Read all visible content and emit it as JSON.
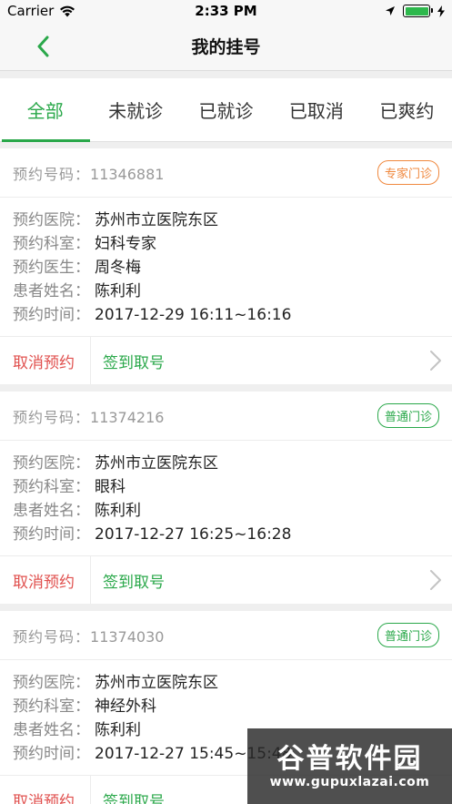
{
  "status_bar": {
    "carrier": "Carrier",
    "time": "2:33 PM"
  },
  "nav": {
    "title": "我的挂号"
  },
  "tabs": [
    {
      "label": "全部",
      "active": true
    },
    {
      "label": "未就诊",
      "active": false
    },
    {
      "label": "已就诊",
      "active": false
    },
    {
      "label": "已取消",
      "active": false
    },
    {
      "label": "已爽约",
      "active": false
    }
  ],
  "labels": {
    "appt_no": "预约号码：",
    "hospital": "预约医院：",
    "department": "预约科室：",
    "doctor": "预约医生：",
    "patient": "患者姓名：",
    "time": "预约时间：",
    "cancel": "取消预约",
    "checkin": "签到取号"
  },
  "appointments": [
    {
      "number": "11346881",
      "badge": "专家门诊",
      "badge_type": "expert",
      "hospital": "苏州市立医院东区",
      "department": "妇科专家",
      "doctor": "周冬梅",
      "patient": "陈利利",
      "time": "2017-12-29 16:11~16:16"
    },
    {
      "number": "11374216",
      "badge": "普通门诊",
      "badge_type": "normal",
      "hospital": "苏州市立医院东区",
      "department": "眼科",
      "patient": "陈利利",
      "time": "2017-12-27 16:25~16:28"
    },
    {
      "number": "11374030",
      "badge": "普通门诊",
      "badge_type": "normal",
      "hospital": "苏州市立医院东区",
      "department": "神经外科",
      "patient": "陈利利",
      "time": "2017-12-27 15:45~15:48"
    }
  ],
  "watermark": {
    "title": "谷普软件园",
    "url": "www.gupuxlazai.com"
  },
  "colors": {
    "accent": "#2aa84a",
    "cancel": "#e0504e",
    "expert": "#f0883e"
  },
  "icons": {
    "back": "chevron-left-icon",
    "disclosure": "chevron-right-icon",
    "wifi": "wifi-icon",
    "location": "location-arrow-icon",
    "battery": "battery-icon"
  }
}
